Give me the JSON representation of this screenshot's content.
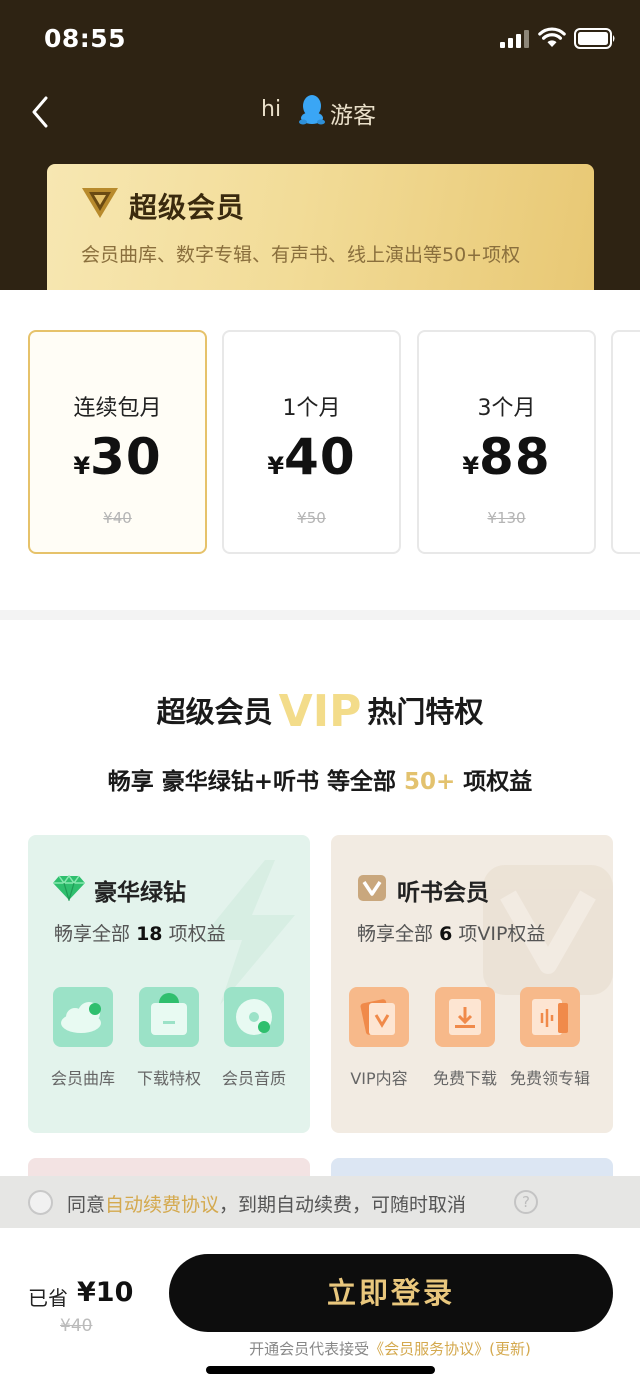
{
  "status_bar": {
    "time": "08:55"
  },
  "nav": {
    "greeting": "hi",
    "username": "游客"
  },
  "vip_banner": {
    "title": "超级会员",
    "description": "会员曲库、数字专辑、有声书、线上演出等50+项权"
  },
  "plans": [
    {
      "name": "连续包月",
      "currency": "¥",
      "price": "30",
      "original": "¥40",
      "selected": true
    },
    {
      "name": "1个月",
      "currency": "¥",
      "price": "40",
      "original": "¥50",
      "selected": false
    },
    {
      "name": "3个月",
      "currency": "¥",
      "price": "88",
      "original": "¥130",
      "selected": false
    }
  ],
  "privileges": {
    "title_before": "超级会员",
    "title_vip": "VIP",
    "title_after": "热门特权",
    "subtitle_prefix": "畅享 豪华绿钻+听书 等全部",
    "subtitle_count": "50+",
    "subtitle_suffix": "项权益"
  },
  "benefit_cards": [
    {
      "title": "豪华绿钻",
      "desc_prefix": "畅享全部",
      "desc_count": "18",
      "desc_suffix": "项权益",
      "features": [
        "会员曲库",
        "下载特权",
        "会员音质"
      ]
    },
    {
      "title": "听书会员",
      "desc_prefix": "畅享全部",
      "desc_count": "6",
      "desc_suffix": "项VIP权益",
      "features": [
        "VIP内容",
        "免费下载",
        "免费领专辑"
      ]
    }
  ],
  "agreement": {
    "prefix": "同意",
    "link": "自动续费协议",
    "suffix": "，到期自动续费，可随时取消",
    "help": "?"
  },
  "bottom": {
    "saved_label": "已省",
    "saved_amount": "¥10",
    "saved_original": "¥40",
    "login_button": "立即登录",
    "terms_prefix": "开通会员代表接受",
    "terms_link": "《会员服务协议》(更新)"
  },
  "colors": {
    "header_bg": "#2e2313",
    "gold_accent": "#e3c26e",
    "button_bg": "#0d0d0d",
    "button_text": "#e9c77d",
    "green_card": "#e3f3ec",
    "beige_card": "#f2ebe2"
  },
  "icons": [
    "signal-icon",
    "wifi-icon",
    "battery-icon",
    "back-icon",
    "qq-penguin-icon",
    "vip-v-logo-icon",
    "green-diamond-icon",
    "audiobook-v-icon",
    "help-icon"
  ]
}
